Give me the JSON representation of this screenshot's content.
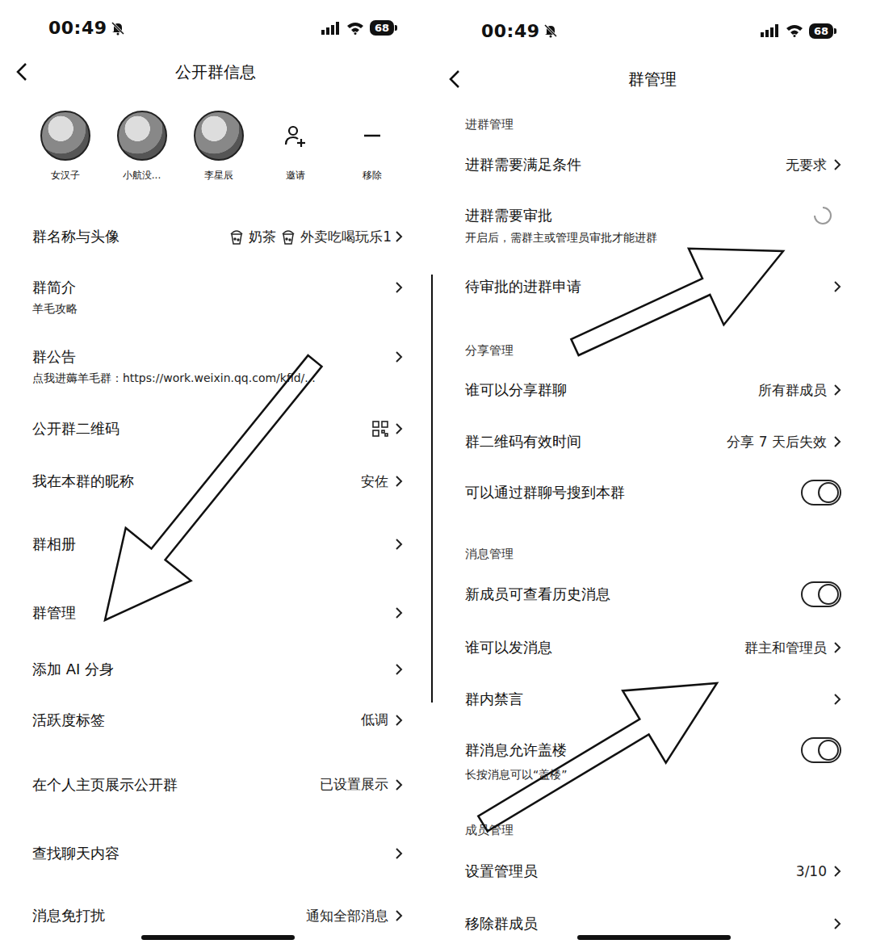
{
  "left": {
    "status_bar": {
      "time": "00:49",
      "battery": "68"
    },
    "header": {
      "title": "公开群信息"
    },
    "members": [
      {
        "name": "女汉子",
        "kind": "avatar"
      },
      {
        "name": "小航没...",
        "kind": "avatar"
      },
      {
        "name": "李星辰",
        "kind": "avatar"
      },
      {
        "name": "邀请",
        "kind": "invite"
      },
      {
        "name": "移除",
        "kind": "remove"
      }
    ],
    "rows": [
      {
        "kind": "name",
        "label": "群名称与头像",
        "value_parts": [
          "奶茶",
          "外卖吃喝玩乐1"
        ]
      },
      {
        "kind": "link",
        "label": "群简介",
        "sublabel": "羊毛攻略"
      },
      {
        "kind": "link",
        "label": "群公告",
        "sublabel": "点我进薅羊毛群：https://work.weixin.qq.com/kfid/..."
      },
      {
        "kind": "qr",
        "label": "公开群二维码"
      },
      {
        "kind": "link",
        "label": "我在本群的昵称",
        "value": "安佐"
      },
      {
        "kind": "link",
        "label": "群相册"
      },
      {
        "kind": "link",
        "label": "群管理"
      },
      {
        "kind": "link",
        "label": "添加 AI 分身"
      },
      {
        "kind": "link",
        "label": "活跃度标签",
        "value": "低调"
      },
      {
        "kind": "link",
        "label": "在个人主页展示公开群",
        "value": "已设置展示"
      },
      {
        "kind": "link",
        "label": "查找聊天内容"
      },
      {
        "kind": "link",
        "label": "消息免打扰",
        "value": "通知全部消息"
      }
    ]
  },
  "right": {
    "status_bar": {
      "time": "00:49",
      "battery": "68"
    },
    "header": {
      "title": "群管理"
    },
    "rows": [
      {
        "kind": "section",
        "label": "进群管理"
      },
      {
        "kind": "link",
        "label": "进群需要满足条件",
        "value": "无要求"
      },
      {
        "kind": "spinner",
        "label": "进群需要审批",
        "sublabel": "开启后，需群主或管理员审批才能进群"
      },
      {
        "kind": "link",
        "label": "待审批的进群申请"
      },
      {
        "kind": "section",
        "label": "分享管理"
      },
      {
        "kind": "link",
        "label": "谁可以分享群聊",
        "value": "所有群成员"
      },
      {
        "kind": "link",
        "label": "群二维码有效时间",
        "value": "分享 7 天后失效"
      },
      {
        "kind": "toggle",
        "label": "可以通过群聊号搜到本群",
        "on": true
      },
      {
        "kind": "section",
        "label": "消息管理"
      },
      {
        "kind": "toggle",
        "label": "新成员可查看历史消息",
        "on": true
      },
      {
        "kind": "link",
        "label": "谁可以发消息",
        "value": "群主和管理员"
      },
      {
        "kind": "link",
        "label": "群内禁言"
      },
      {
        "kind": "toggle",
        "label": "群消息允许盖楼",
        "sublabel": "长按消息可以“盖楼”",
        "on": true
      },
      {
        "kind": "section",
        "label": "成员管理"
      },
      {
        "kind": "link",
        "label": "设置管理员",
        "value": "3/10"
      },
      {
        "kind": "link",
        "label": "移除群成员"
      }
    ]
  }
}
